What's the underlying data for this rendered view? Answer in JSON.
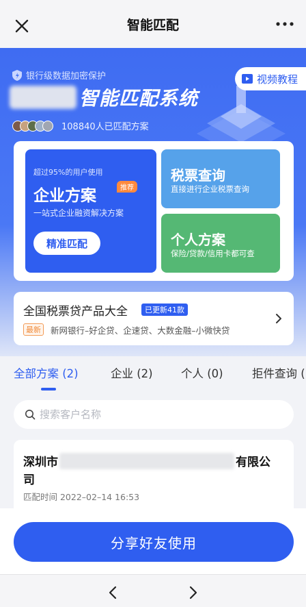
{
  "topbar": {
    "title": "智能匹配"
  },
  "hero": {
    "secure_text": "银行级数据加密保护",
    "video_label": "视频教程",
    "brand_title": "智能匹配系统",
    "matched_text": "108840人已匹配方案",
    "avatar_colors": [
      "#7c5b4a",
      "#c7a27f",
      "#5e6f4a",
      "#9db0c8",
      "#a0a6b2"
    ]
  },
  "plans": {
    "business": {
      "subtitle": "超过95%的用户使用",
      "name": "企业方案",
      "tag": "推荐",
      "desc": "一站式企业融资解决方案",
      "button": "精准匹配"
    },
    "tax": {
      "name": "税票查询",
      "desc": "直接进行企业税票查询"
    },
    "personal": {
      "name": "个人方案",
      "desc": "保险/贷款/信用卡都可查"
    }
  },
  "products": {
    "title": "全国税票贷产品大全",
    "update_badge": "已更新41款",
    "new_tag": "最新",
    "subtitle": "新网银行–好企贷、企速贷、大数金融–小微快贷"
  },
  "tabs": [
    {
      "label": "全部方案 (2)"
    },
    {
      "label": "企业 (2)"
    },
    {
      "label": "个人 (0)"
    },
    {
      "label": "拒件查询 ("
    }
  ],
  "search": {
    "placeholder": "搜索客户名称",
    "value": ""
  },
  "result": {
    "prefix": "深圳市",
    "suffix": "有限公",
    "line2": "司",
    "time": "匹配时间 2022–02–14 16:53"
  },
  "share_button": "分享好友使用",
  "colors": {
    "primary": "#2f5ef0",
    "tax": "#56a2ea",
    "personal": "#55b874",
    "tag": "#ff8a3d"
  }
}
